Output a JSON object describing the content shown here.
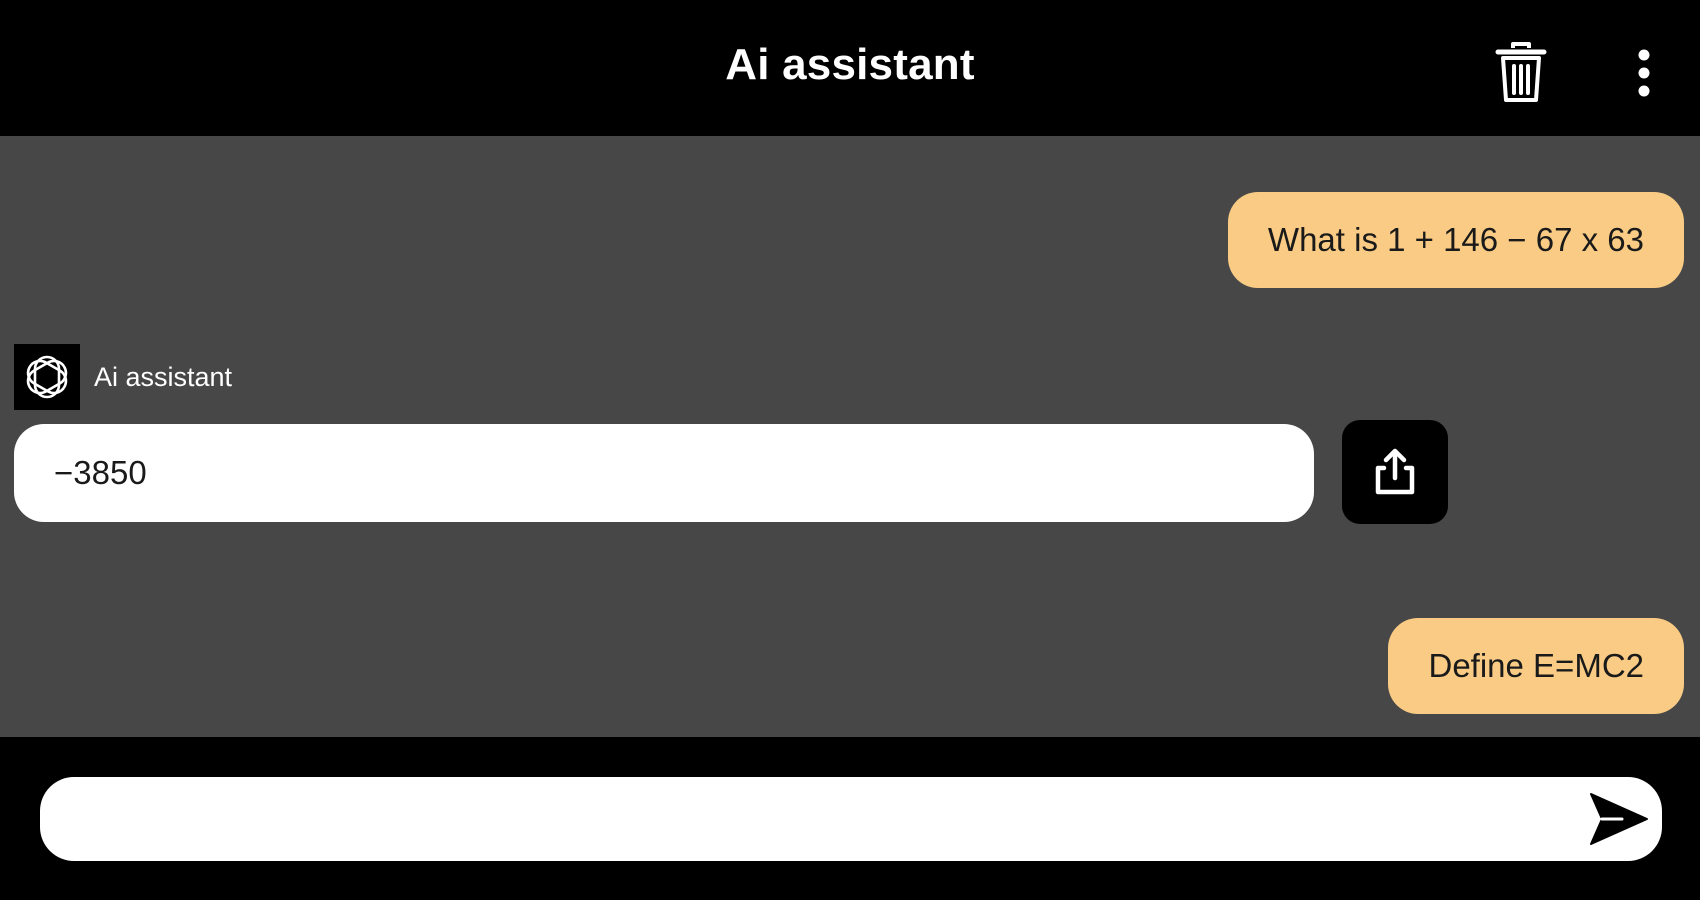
{
  "header": {
    "title": "Ai assistant",
    "icons": [
      "trash-icon",
      "more-vertical-icon"
    ]
  },
  "chat": {
    "messages": [
      {
        "role": "user",
        "text": "What is 1 + 146 − 67 x 63"
      },
      {
        "role": "assistant",
        "sender": "Ai assistant",
        "text": "−3850",
        "avatar_icon": "openai-logo-icon",
        "action_icon": "share-icon"
      },
      {
        "role": "user",
        "text": "Define E=MC2"
      }
    ]
  },
  "composer": {
    "input_value": "",
    "send_icon": "send-icon"
  },
  "colors": {
    "header_bg": "#000000",
    "chat_bg": "#474747",
    "user_bubble": "#f9cb84",
    "assistant_bubble": "#ffffff"
  }
}
